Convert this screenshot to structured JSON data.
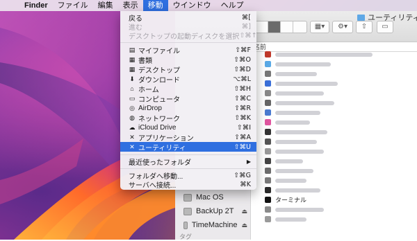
{
  "menubar": {
    "items": [
      {
        "label": "Finder",
        "bold": true
      },
      {
        "label": "ファイル"
      },
      {
        "label": "編集"
      },
      {
        "label": "表示"
      },
      {
        "label": "移動",
        "active": true
      },
      {
        "label": "ウインドウ"
      },
      {
        "label": "ヘルプ"
      }
    ]
  },
  "finder": {
    "title": "ユーティリティ",
    "column_header": "名前",
    "sidebar": [
      {
        "label": "Mac OS",
        "eject": ""
      },
      {
        "label": "BackUp 2T",
        "eject": "⏏"
      },
      {
        "label": "TimeMachine",
        "eject": "⏏"
      }
    ],
    "sidebar_section": "タグ",
    "visible_file": "ターミナル"
  },
  "go_menu": {
    "items": [
      {
        "label": "戻る",
        "shortcut": "⌘[",
        "disabled": false
      },
      {
        "label": "進む",
        "shortcut": "⌘]",
        "disabled": true
      },
      {
        "label": "デスクトップの起動ディスクを選択",
        "shortcut": "⇧⌘↑",
        "disabled": true
      },
      {
        "label": "マイファイル",
        "shortcut": "⇧⌘F",
        "icon": "all-files-icon"
      },
      {
        "label": "書類",
        "shortcut": "⇧⌘O",
        "icon": "documents-icon"
      },
      {
        "label": "デスクトップ",
        "shortcut": "⇧⌘D",
        "icon": "desktop-icon"
      },
      {
        "label": "ダウンロード",
        "shortcut": "⌥⌘L",
        "icon": "download-icon"
      },
      {
        "label": "ホーム",
        "shortcut": "⇧⌘H",
        "icon": "home-icon"
      },
      {
        "label": "コンピュータ",
        "shortcut": "⇧⌘C",
        "icon": "computer-icon"
      },
      {
        "label": "AirDrop",
        "shortcut": "⇧⌘R",
        "icon": "airdrop-icon"
      },
      {
        "label": "ネットワーク",
        "shortcut": "⇧⌘K",
        "icon": "network-icon"
      },
      {
        "label": "iCloud Drive",
        "shortcut": "⇧⌘I",
        "icon": "cloud-icon"
      },
      {
        "label": "アプリケーション",
        "shortcut": "⇧⌘A",
        "icon": "applications-icon"
      },
      {
        "label": "ユーティリティ",
        "shortcut": "⇧⌘U",
        "icon": "utilities-icon",
        "highlighted": true
      },
      {
        "label": "最近使ったフォルダ",
        "submenu": "▶"
      },
      {
        "label": "フォルダへ移動...",
        "shortcut": "⇧⌘G"
      },
      {
        "label": "サーバへ接続...",
        "shortcut": "⌘K"
      }
    ]
  },
  "colors": {
    "accent": "#2f6fe0",
    "menu_bg": "#f2f0f4"
  }
}
